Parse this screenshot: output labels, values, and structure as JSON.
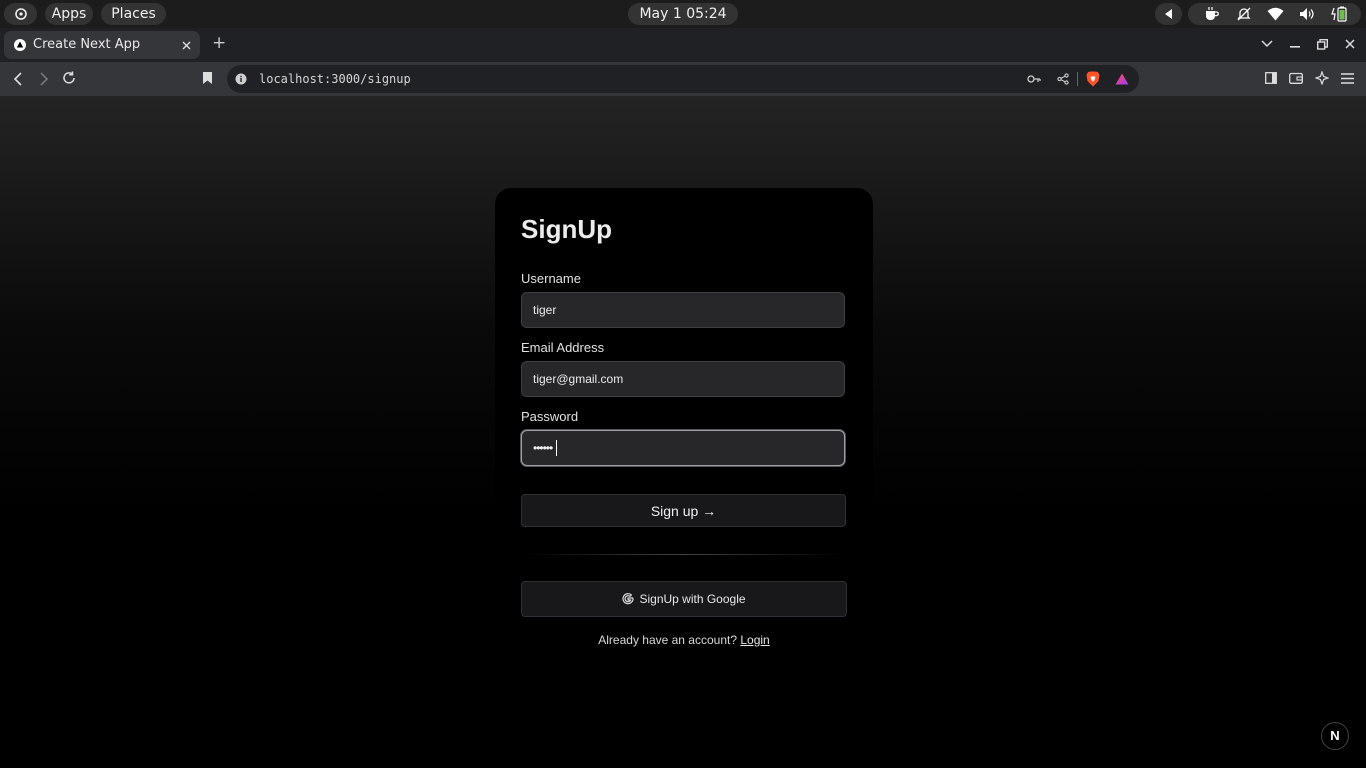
{
  "system_bar": {
    "apps_label": "Apps",
    "places_label": "Places",
    "clock": "May 1  05:24"
  },
  "browser": {
    "tab_title": "Create Next App",
    "new_tab_symbol": "+",
    "url": "localhost:3000/signup"
  },
  "form": {
    "title": "SignUp",
    "username_label": "Username",
    "username_value": "tiger",
    "email_label": "Email Address",
    "email_value": "tiger@gmail.com",
    "password_label": "Password",
    "password_mask": "••••••",
    "signup_button": "Sign up →",
    "google_button": "SignUp with Google",
    "account_prompt": "Already have an account?",
    "login_link": "Login"
  },
  "next_badge": "N",
  "icons": [
    "gnome-logo-icon",
    "play-left-icon",
    "coffee-icon",
    "bell-off-icon",
    "wifi-icon",
    "volume-icon",
    "battery-icon",
    "back-icon",
    "forward-icon",
    "reload-icon",
    "bookmark-icon",
    "info-icon",
    "key-icon",
    "share-icon",
    "brave-icon",
    "rewards-icon",
    "sidebar-icon",
    "wallet-icon",
    "leo-icon",
    "menu-icon",
    "google-icon"
  ]
}
